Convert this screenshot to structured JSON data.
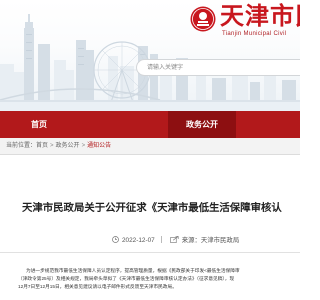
{
  "header": {
    "site_title": "天津市民",
    "site_subtitle": "Tianjin Municipal Civil",
    "search_placeholder": "请输入关键字"
  },
  "nav": {
    "items": [
      {
        "label": "首页",
        "active": false
      },
      {
        "label": "政务公开",
        "active": true
      }
    ]
  },
  "breadcrumb": {
    "current_label": "当前位置：",
    "home": "首页",
    "section": "政务公开",
    "current": "通知公告",
    "separator": ">"
  },
  "article": {
    "title": "天津市民政局关于公开征求《天津市最低生活保障审核认",
    "publish_date": "2022-12-07",
    "source": "来源：天津市民政局",
    "body_lines": [
      "为进一步规范我市最低生活保障人员认定程序，提高管理质量，根据《民政部关于印发<最低生活保障审",
      "（津政令第25号）及相关规定，我局牵头草拟了《天津市最低生活保障审核认定办法》（征求意见稿），现",
      "12月7日至12月15日，相关意见建议请以电子邮件形式反馈至天津市民政局。"
    ]
  },
  "colors": {
    "brand_red": "#b2191b",
    "nav_active": "#8d0f11",
    "title_red": "#c8171e"
  },
  "icons": [
    "tianjin-emblem-icon",
    "clock-icon",
    "share-icon"
  ]
}
